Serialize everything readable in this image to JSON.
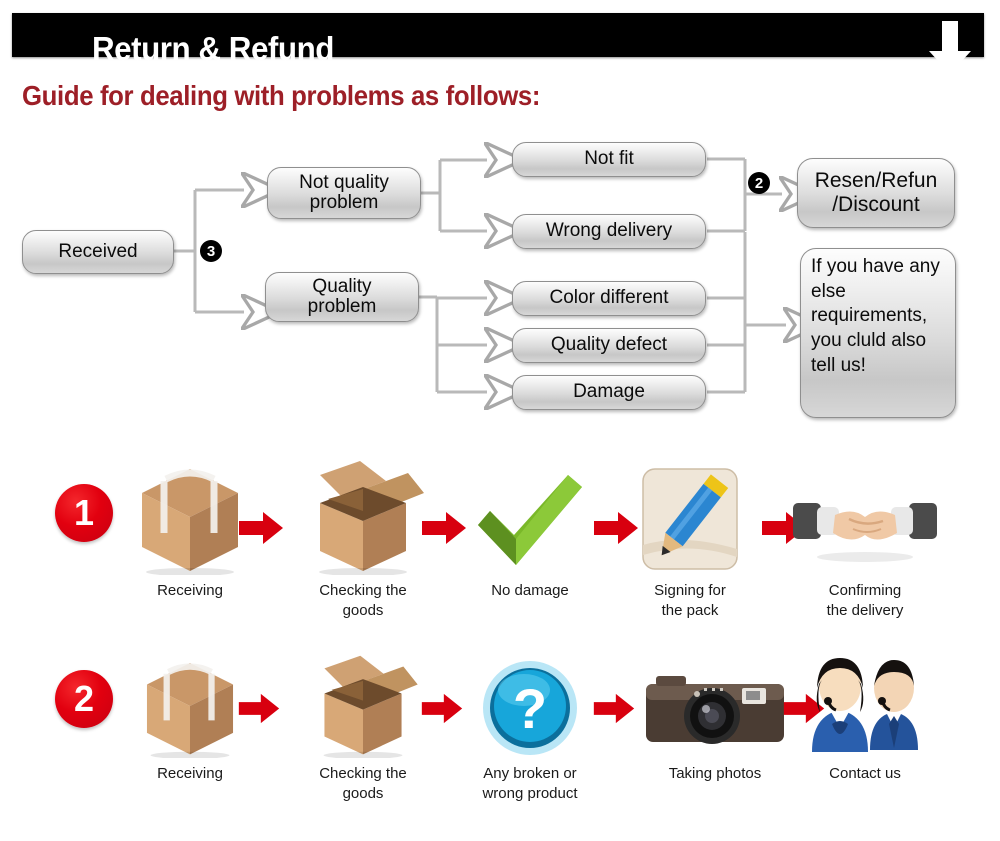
{
  "header": {
    "title": "Return & Refund",
    "arrow_icon": "down-arrow-icon"
  },
  "subtitle": "Guide for dealing with problems as follows:",
  "colors": {
    "header_bg": "#000000",
    "header_text": "#ffffff",
    "subtitle_text": "#9d1f27",
    "accent_red": "#d8000f",
    "node_border": "#8f8f8f",
    "page_bg": "#ffffff"
  },
  "flowchart": {
    "nodes": {
      "received": "Received",
      "not_quality_problem": "Not quality\nproblem",
      "quality_problem": "Quality\nproblem",
      "not_fit": "Not fit",
      "wrong_delivery": "Wrong delivery",
      "color_different": "Color different",
      "quality_defect": "Quality defect",
      "damage": "Damage",
      "resend_refund": "Resen/Refun\n/Discount",
      "extra_requirements": "If you have any else requirements, you cluld also tell us!"
    },
    "badges": {
      "branch_three": "3",
      "branch_two": "2"
    }
  },
  "process_rows": [
    {
      "number": "1",
      "steps": [
        {
          "icon": "sealed-box-icon",
          "caption": "Receiving"
        },
        {
          "icon": "open-box-icon",
          "caption": "Checking the\ngoods"
        },
        {
          "icon": "green-check-icon",
          "caption": "No damage"
        },
        {
          "icon": "pencil-sign-icon",
          "caption": "Signing for\nthe pack"
        },
        {
          "icon": "handshake-icon",
          "caption": "Confirming\nthe delivery"
        }
      ]
    },
    {
      "number": "2",
      "steps": [
        {
          "icon": "sealed-box-icon",
          "caption": "Receiving"
        },
        {
          "icon": "open-box-icon",
          "caption": "Checking the\ngoods"
        },
        {
          "icon": "question-mark-icon",
          "caption": "Any broken or\nwrong product"
        },
        {
          "icon": "camera-icon",
          "caption": "Taking photos"
        },
        {
          "icon": "support-agents-icon",
          "caption": "Contact us"
        }
      ]
    }
  ]
}
